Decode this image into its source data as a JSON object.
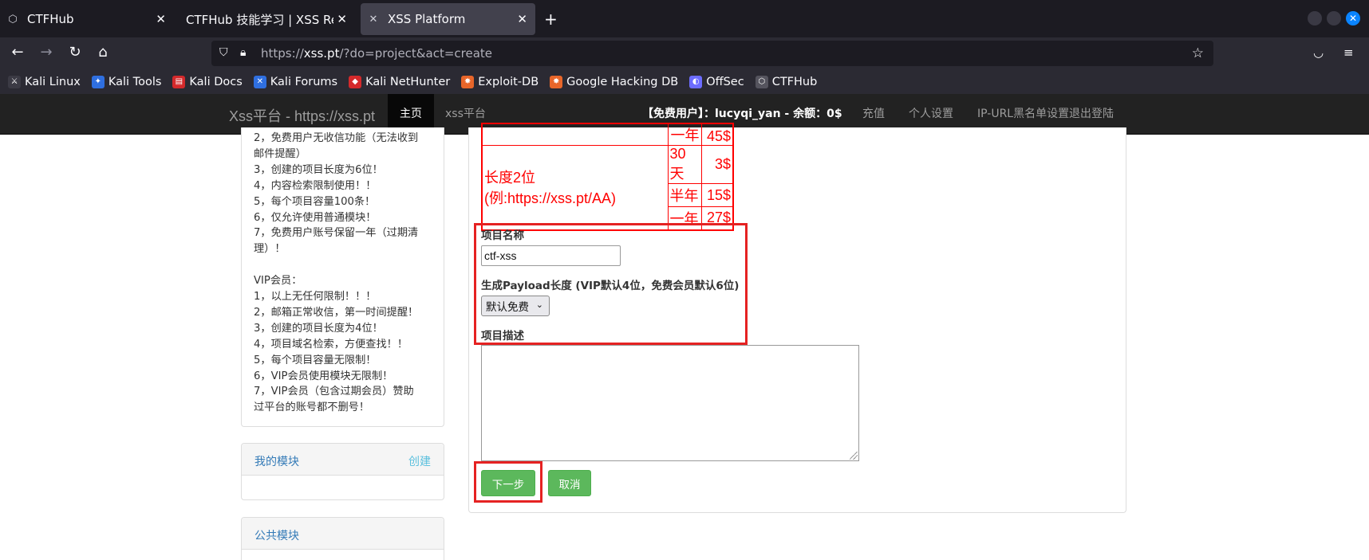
{
  "browser": {
    "tabs": [
      {
        "title": "CTFHub",
        "active": false
      },
      {
        "title": "CTFHub 技能学习 | XSS Refle",
        "active": false
      },
      {
        "title": "XSS Platform",
        "active": true
      }
    ],
    "url": {
      "prefix": "https://",
      "host": "xss.pt",
      "path": "/?do=project&act=create"
    },
    "bookmarks": [
      {
        "label": "Kali Linux",
        "icon": "kali-dragon-icon",
        "color": "#2b2a33"
      },
      {
        "label": "Kali Tools",
        "icon": "kali-tools-icon",
        "color": "#2f6fe0"
      },
      {
        "label": "Kali Docs",
        "icon": "kali-docs-icon",
        "color": "#d4292b"
      },
      {
        "label": "Kali Forums",
        "icon": "kali-forums-icon",
        "color": "#2f6fe0"
      },
      {
        "label": "Kali NetHunter",
        "icon": "nethunter-icon",
        "color": "#d4292b"
      },
      {
        "label": "Exploit-DB",
        "icon": "exploit-db-icon",
        "color": "#e8662a"
      },
      {
        "label": "Google Hacking DB",
        "icon": "ghdb-icon",
        "color": "#e8662a"
      },
      {
        "label": "OffSec",
        "icon": "offsec-icon",
        "color": "#6c6cff"
      },
      {
        "label": "CTFHub",
        "icon": "ctfhub-icon",
        "color": "#8f8f9d"
      }
    ]
  },
  "site": {
    "brand": "Xss平台 - https://xss.pt",
    "nav": [
      "主页",
      "xss平台"
    ],
    "user_info": "【免费用户】：lucyqi_yan - 余额：0$",
    "right_nav": [
      "充值",
      "个人设置",
      "IP-URL黑名单设置",
      "退出登陆"
    ]
  },
  "notice": {
    "lines": [
      "2，免费用户无收信功能（无法收到",
      "邮件提醒）",
      "3，创建的项目长度为6位！",
      "4，内容检索限制使用！！",
      "5，每个项目容量100条！",
      "6，仅允许使用普通模块！",
      "7，免费用户账号保留一年（过期清",
      "理）！",
      "",
      "VIP会员：",
      "1，以上无任何限制！！！",
      "2，邮箱正常收信，第一时间提醒！",
      "3，创建的项目长度为4位！",
      "4，项目域名检索，方便查找！！",
      "5，每个项目容量无限制！",
      "6，VIP会员使用模块无限制！",
      "7，VIP会员（包含过期会员）赞助",
      "过平台的账号都不删号！"
    ]
  },
  "modules": {
    "my_title": "我的模块",
    "create_link": "创建",
    "public_title": "公共模块"
  },
  "pricing": {
    "partial_row": {
      "period": "一年",
      "price": "45$"
    },
    "group_label": "长度2位(例:https://xss.pt/AA)",
    "rows": [
      {
        "period": "30天",
        "price": "3$"
      },
      {
        "period": "半年",
        "price": "15$"
      },
      {
        "period": "一年",
        "price": "27$"
      }
    ]
  },
  "form": {
    "name_label": "项目名称",
    "name_value": "ctf-xss",
    "payload_label": "生成Payload长度 (VIP默认4位，免费会员默认6位)",
    "payload_selected": "默认免费",
    "desc_label": "项目描述",
    "desc_value": "",
    "next_button": "下一步",
    "cancel_button": "取消"
  }
}
